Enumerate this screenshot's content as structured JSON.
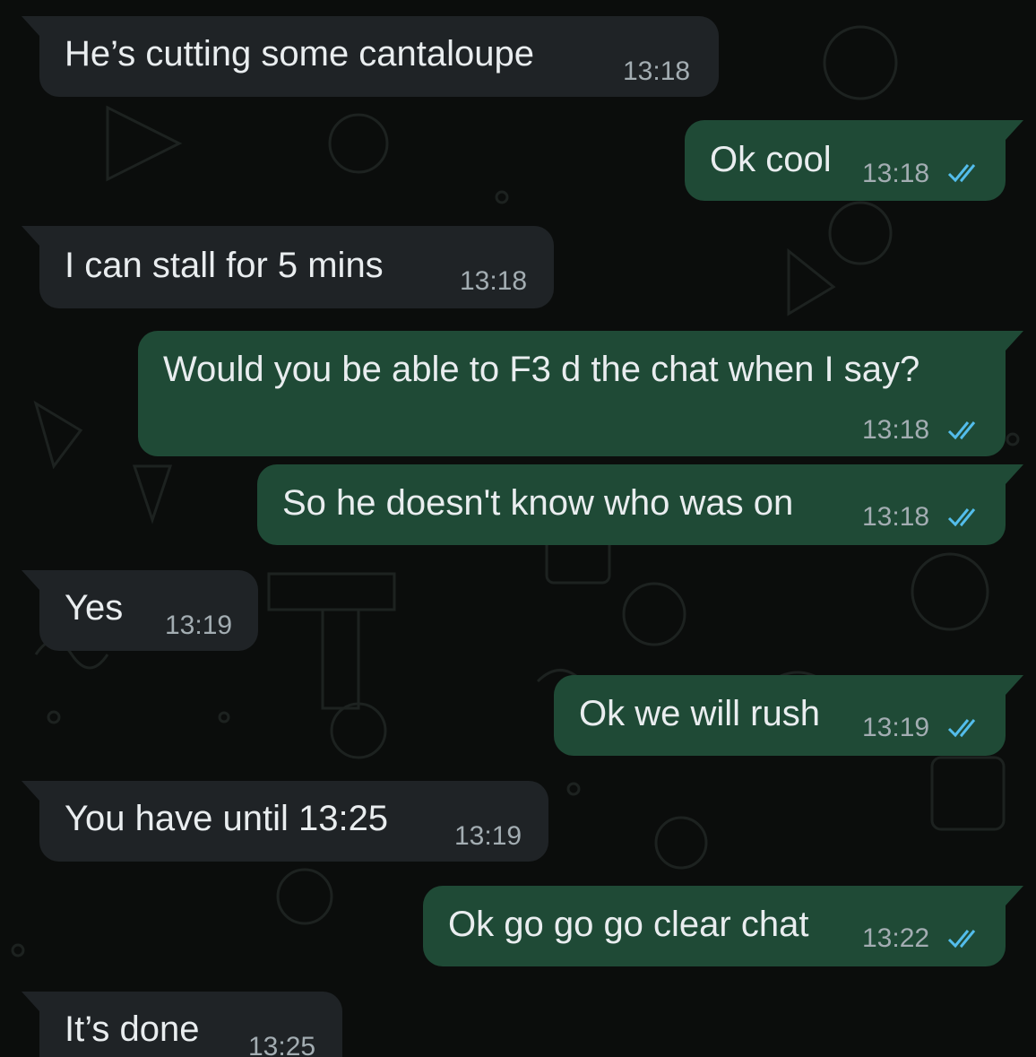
{
  "messages": [
    {
      "direction": "incoming",
      "text": "He’s cutting some cantaloupe",
      "time": "13:18"
    },
    {
      "direction": "outgoing",
      "text": "Ok cool",
      "time": "13:18",
      "status": "read"
    },
    {
      "direction": "incoming",
      "text": "I can stall for 5 mins",
      "time": "13:18"
    },
    {
      "direction": "outgoing",
      "text": "Would you be able to F3 d the chat when I say?",
      "time": "13:18",
      "status": "read"
    },
    {
      "direction": "outgoing",
      "text": "So he doesn't know who was on",
      "time": "13:18",
      "status": "read"
    },
    {
      "direction": "incoming",
      "text": "Yes",
      "time": "13:19"
    },
    {
      "direction": "outgoing",
      "text": "Ok we will rush",
      "time": "13:19",
      "status": "read"
    },
    {
      "direction": "incoming",
      "text": "You have until 13:25",
      "time": "13:19"
    },
    {
      "direction": "outgoing",
      "text": "Ok go go go clear chat",
      "time": "13:22",
      "status": "read"
    },
    {
      "direction": "incoming",
      "text": "It’s done",
      "time": "13:25"
    }
  ],
  "colors": {
    "background": "#0b0d0c",
    "incoming_bubble": "#1f2326",
    "outgoing_bubble": "#1f4a36",
    "text": "#e9edef",
    "timestamp": "#a3adb2",
    "read_ticks": "#53bdeb"
  },
  "icons": {
    "read_receipt": "double-check-icon"
  }
}
